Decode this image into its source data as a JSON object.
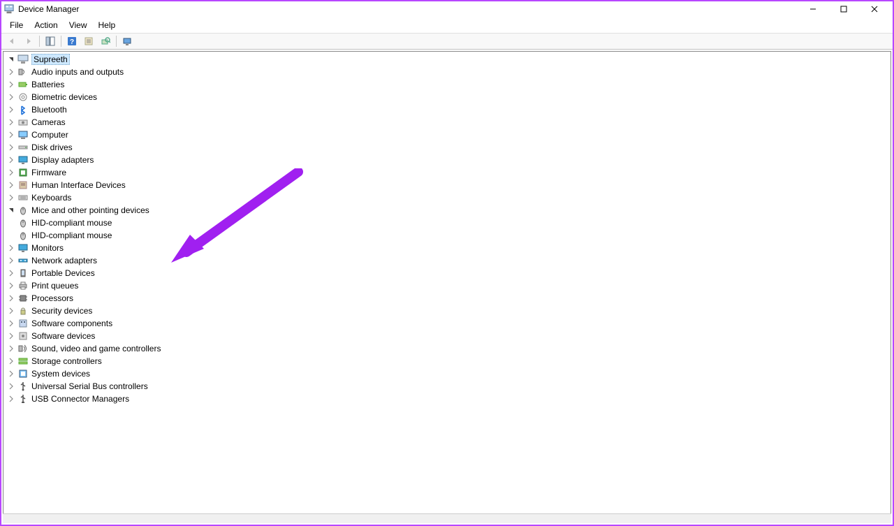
{
  "window": {
    "title": "Device Manager"
  },
  "menu": {
    "file": "File",
    "action": "Action",
    "view": "View",
    "help": "Help"
  },
  "tree": {
    "root": "Supreeth",
    "items": [
      {
        "label": "Audio inputs and outputs",
        "icon": "audio"
      },
      {
        "label": "Batteries",
        "icon": "battery"
      },
      {
        "label": "Biometric devices",
        "icon": "biometric"
      },
      {
        "label": "Bluetooth",
        "icon": "bluetooth"
      },
      {
        "label": "Cameras",
        "icon": "camera"
      },
      {
        "label": "Computer",
        "icon": "computer"
      },
      {
        "label": "Disk drives",
        "icon": "disk"
      },
      {
        "label": "Display adapters",
        "icon": "display"
      },
      {
        "label": "Firmware",
        "icon": "firmware"
      },
      {
        "label": "Human Interface Devices",
        "icon": "hid"
      },
      {
        "label": "Keyboards",
        "icon": "keyboard"
      },
      {
        "label": "Mice and other pointing devices",
        "icon": "mouse",
        "expanded": true,
        "children": [
          {
            "label": "HID-compliant mouse",
            "icon": "mouse"
          },
          {
            "label": "HID-compliant mouse",
            "icon": "mouse"
          }
        ]
      },
      {
        "label": "Monitors",
        "icon": "monitor"
      },
      {
        "label": "Network adapters",
        "icon": "network"
      },
      {
        "label": "Portable Devices",
        "icon": "portable"
      },
      {
        "label": "Print queues",
        "icon": "printer"
      },
      {
        "label": "Processors",
        "icon": "processor"
      },
      {
        "label": "Security devices",
        "icon": "security"
      },
      {
        "label": "Software components",
        "icon": "software"
      },
      {
        "label": "Software devices",
        "icon": "softwaredev"
      },
      {
        "label": "Sound, video and game controllers",
        "icon": "sound"
      },
      {
        "label": "Storage controllers",
        "icon": "storage"
      },
      {
        "label": "System devices",
        "icon": "system"
      },
      {
        "label": "Universal Serial Bus controllers",
        "icon": "usb"
      },
      {
        "label": "USB Connector Managers",
        "icon": "usbconn"
      }
    ]
  }
}
